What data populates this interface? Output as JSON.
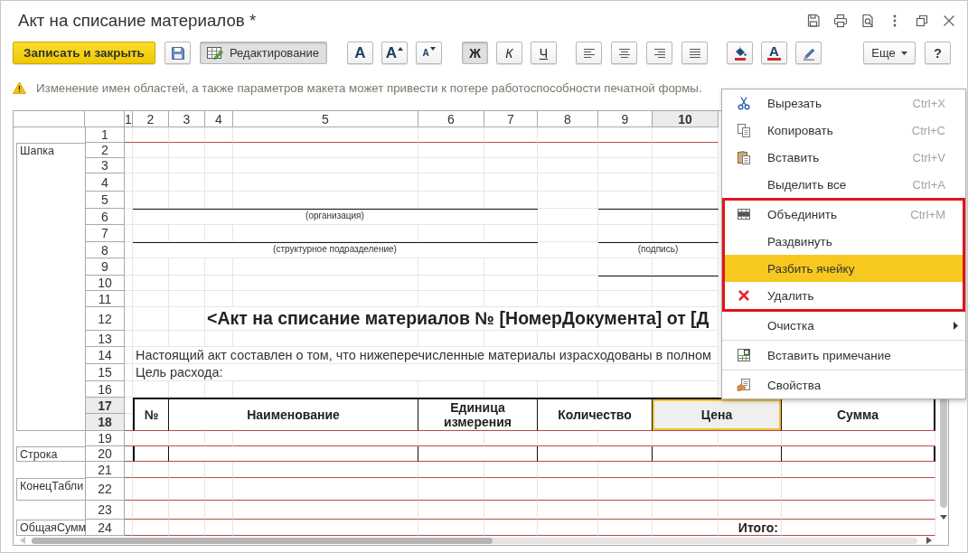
{
  "window": {
    "title": "Акт на списание материалов *"
  },
  "toolbar": {
    "save_close": {
      "label": "Записать и закрыть"
    },
    "edit_mode": {
      "label": "Редактирование",
      "pressed": true
    },
    "font_size": [
      {
        "kind": "normal",
        "label": "A"
      },
      {
        "kind": "increase",
        "label": "A"
      },
      {
        "kind": "decrease",
        "label": "A"
      }
    ],
    "font_style": [
      {
        "kind": "bold",
        "label": "Ж",
        "pressed": true
      },
      {
        "kind": "italic",
        "label": "К",
        "pressed": false
      },
      {
        "kind": "underline",
        "label": "Ч",
        "pressed": false
      }
    ],
    "text_color": {
      "label": "A"
    },
    "more": {
      "label": "Еще"
    },
    "help": {
      "label": "?"
    }
  },
  "warning": {
    "text": "Изменение имен областей, а также параметров макета может привести к потере работоспособности печатной формы."
  },
  "sheet": {
    "columns": [
      {
        "label": "1",
        "selected": false
      },
      {
        "label": "2",
        "selected": false
      },
      {
        "label": "3",
        "selected": false
      },
      {
        "label": "4",
        "selected": false
      },
      {
        "label": "5",
        "selected": false
      },
      {
        "label": "6",
        "selected": false
      },
      {
        "label": "7",
        "selected": false
      },
      {
        "label": "8",
        "selected": false
      },
      {
        "label": "9",
        "selected": false
      },
      {
        "label": "10",
        "selected": true
      }
    ],
    "rows": [
      {
        "number": "1",
        "selected": false
      },
      {
        "number": "2",
        "selected": false
      },
      {
        "number": "3",
        "selected": false
      },
      {
        "number": "4",
        "selected": false
      },
      {
        "number": "5",
        "selected": false
      },
      {
        "number": "6",
        "selected": false
      },
      {
        "number": "7",
        "selected": false
      },
      {
        "number": "8",
        "selected": false
      },
      {
        "number": "9",
        "selected": false
      },
      {
        "number": "10",
        "selected": false
      },
      {
        "number": "11",
        "selected": false
      },
      {
        "number": "12",
        "selected": false
      },
      {
        "number": "13",
        "selected": false
      },
      {
        "number": "14",
        "selected": false
      },
      {
        "number": "15",
        "selected": false
      },
      {
        "number": "16",
        "selected": false
      },
      {
        "number": "17",
        "selected": true
      },
      {
        "number": "18",
        "selected": true
      },
      {
        "number": "19",
        "selected": false
      },
      {
        "number": "20",
        "selected": false
      },
      {
        "number": "21",
        "selected": false
      },
      {
        "number": "22",
        "selected": false
      },
      {
        "number": "23",
        "selected": false
      },
      {
        "number": "24",
        "selected": false
      }
    ],
    "areas": [
      {
        "name": "Шапка"
      },
      {
        "name": "Строка"
      },
      {
        "name": "КонецТабли"
      },
      {
        "name": "ОбщаяСумм"
      }
    ],
    "captions": [
      "(организация)",
      "(структурное подразделение)",
      "(подпись)"
    ],
    "heading": "<Акт на списание материалов № [НомерДокумента] от [Д",
    "paragraphs": [
      "Настоящий акт составлен о том, что нижеперечисленные материалы израсходованы в полном",
      "Цель расхода:"
    ],
    "table_header": [
      {
        "label": "№",
        "selected": false
      },
      {
        "label": "Наименование",
        "selected": false
      },
      {
        "label": "Единица измерения",
        "selected": false
      },
      {
        "label": "Количество",
        "selected": false
      },
      {
        "label": "Цена",
        "selected": true
      },
      {
        "label": "Сумма",
        "selected": false
      }
    ],
    "total_label": "Итого:"
  },
  "context_menu": {
    "sections": [
      {
        "kind": "plain",
        "items": [
          {
            "label": "Вырезать",
            "shortcut": "Ctrl+X",
            "selected": false,
            "submenu": false
          },
          {
            "label": "Копировать",
            "shortcut": "Ctrl+C",
            "selected": false,
            "submenu": false
          },
          {
            "label": "Вставить",
            "shortcut": "Ctrl+V",
            "selected": false,
            "submenu": false
          },
          {
            "label": "Выделить все",
            "shortcut": "Ctrl+A",
            "selected": false,
            "submenu": false
          }
        ]
      },
      {
        "kind": "framed",
        "items": [
          {
            "label": "Объединить",
            "shortcut": "Ctrl+M",
            "selected": false,
            "submenu": false
          },
          {
            "label": "Раздвинуть",
            "selected": false,
            "submenu": false
          },
          {
            "label": "Разбить ячейку",
            "selected": true,
            "submenu": false
          },
          {
            "label": "Удалить",
            "selected": false,
            "submenu": false
          }
        ]
      },
      {
        "kind": "plain",
        "items": [
          {
            "label": "Очистка",
            "selected": false,
            "submenu": true
          }
        ]
      },
      {
        "kind": "plain",
        "items": [
          {
            "label": "Вставить примечание",
            "selected": false,
            "submenu": false
          }
        ]
      },
      {
        "kind": "plain",
        "items": [
          {
            "label": "Свойства",
            "selected": false,
            "submenu": false
          }
        ]
      }
    ]
  }
}
